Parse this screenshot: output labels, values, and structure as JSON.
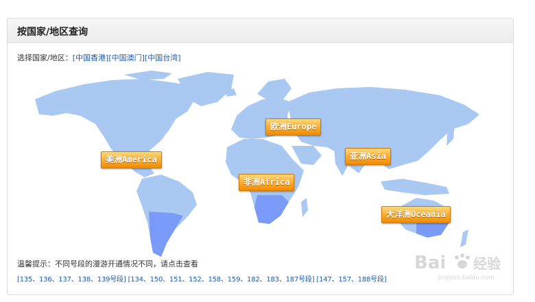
{
  "panel": {
    "title": "按国家/地区查询"
  },
  "region_select": {
    "label": "选择国家/地区：",
    "links": [
      "[中国香港]",
      "[中国澳门]",
      "[中国台湾]"
    ]
  },
  "continents": [
    {
      "label": "美洲America"
    },
    {
      "label": "欧洲Europe"
    },
    {
      "label": "亚洲Asia"
    },
    {
      "label": "非洲Africa"
    },
    {
      "label": "大洋洲Oceania"
    }
  ],
  "tip": {
    "text": "温馨提示：不同号段的漫游开通情况不同，请点击查看"
  },
  "segments": [
    "[135、136、137、138、139号段]",
    "[134、150、151、152、158、159、182、183、187号段]",
    "[147、157、188号段]"
  ],
  "watermark": {
    "brand": "Bai",
    "suffix": "经验",
    "url": "jingyan.baidu.com"
  },
  "colors": {
    "land": "#a9c8f2",
    "land_highlight": "#7a9af7",
    "button": "#f39a12",
    "link": "#1e5aa8"
  }
}
